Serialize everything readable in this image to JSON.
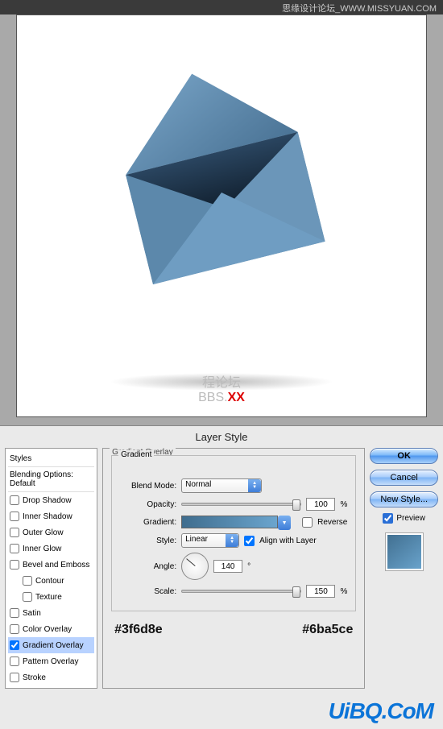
{
  "topbar": {
    "text": "思缘设计论坛_WWW.MISSYUAN.COM"
  },
  "canvas": {
    "watermark_left": "程论坛",
    "watermark_prefix": "BBS.",
    "watermark_xx": "XX"
  },
  "dialog": {
    "title": "Layer Style",
    "styles_header": "Styles",
    "blending_header": "Blending Options: Default",
    "items": [
      {
        "label": "Drop Shadow",
        "checked": false
      },
      {
        "label": "Inner Shadow",
        "checked": false
      },
      {
        "label": "Outer Glow",
        "checked": false
      },
      {
        "label": "Inner Glow",
        "checked": false
      },
      {
        "label": "Bevel and Emboss",
        "checked": false
      },
      {
        "label": "Contour",
        "checked": false,
        "indent": true
      },
      {
        "label": "Texture",
        "checked": false,
        "indent": true
      },
      {
        "label": "Satin",
        "checked": false
      },
      {
        "label": "Color Overlay",
        "checked": false
      },
      {
        "label": "Gradient Overlay",
        "checked": true,
        "selected": true
      },
      {
        "label": "Pattern Overlay",
        "checked": false
      },
      {
        "label": "Stroke",
        "checked": false
      }
    ],
    "panel": {
      "group": "Gradient Overlay",
      "subgroup": "Gradient",
      "blend_mode_label": "Blend Mode:",
      "blend_mode": "Normal",
      "opacity_label": "Opacity:",
      "opacity": "100",
      "pct": "%",
      "gradient_label": "Gradient:",
      "reverse_label": "Reverse",
      "style_label": "Style:",
      "style_value": "Linear",
      "align_label": "Align with Layer",
      "angle_label": "Angle:",
      "angle": "140",
      "deg": "°",
      "scale_label": "Scale:",
      "scale": "150",
      "color1": "#3f6d8e",
      "color2": "#6ba5ce"
    },
    "buttons": {
      "ok": "OK",
      "cancel": "Cancel",
      "new_style": "New Style...",
      "preview": "Preview"
    }
  },
  "footer": {
    "brand": "UiBQ.CoM"
  }
}
